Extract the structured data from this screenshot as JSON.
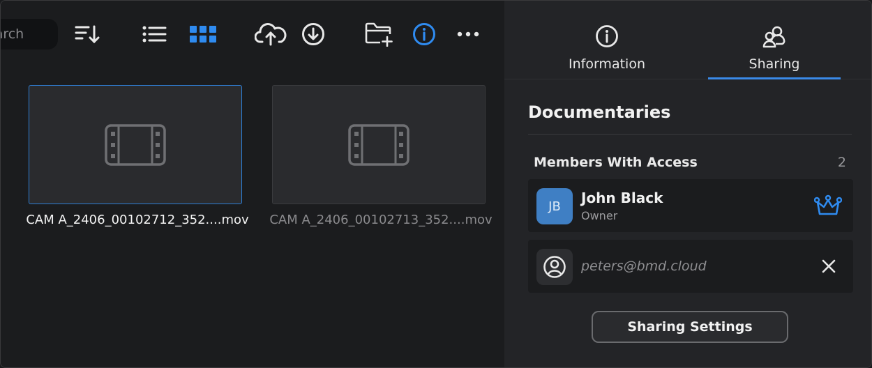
{
  "toolbar": {
    "search_placeholder": "Search",
    "search_visible_text": "earch",
    "icons": [
      "sort-descending-icon",
      "list-view-icon",
      "grid-view-icon",
      "cloud-upload-icon",
      "download-icon",
      "new-folder-icon",
      "info-icon",
      "more-icon"
    ],
    "active_color": "#2f8bf0"
  },
  "files": [
    {
      "name": "CAM A_2406_00102712_352....mov",
      "selected": true
    },
    {
      "name": "CAM A_2406_00102713_352....mov",
      "selected": false
    }
  ],
  "panel": {
    "tabs": [
      {
        "label": "Information",
        "icon": "info-icon",
        "active": false
      },
      {
        "label": "Sharing",
        "icon": "people-icon",
        "active": true
      }
    ],
    "folder_title": "Documentaries",
    "members_heading": "Members With Access",
    "members_count": "2",
    "members": [
      {
        "initials": "JB",
        "name": "John Black",
        "role": "Owner",
        "avatar_color": "#3f7fc4",
        "badge_icon": "crown-icon"
      }
    ],
    "invitee": {
      "email": "peters@bmd.cloud",
      "icon": "user-circle-icon",
      "action_icon": "close-icon"
    },
    "sharing_settings_label": "Sharing Settings"
  }
}
